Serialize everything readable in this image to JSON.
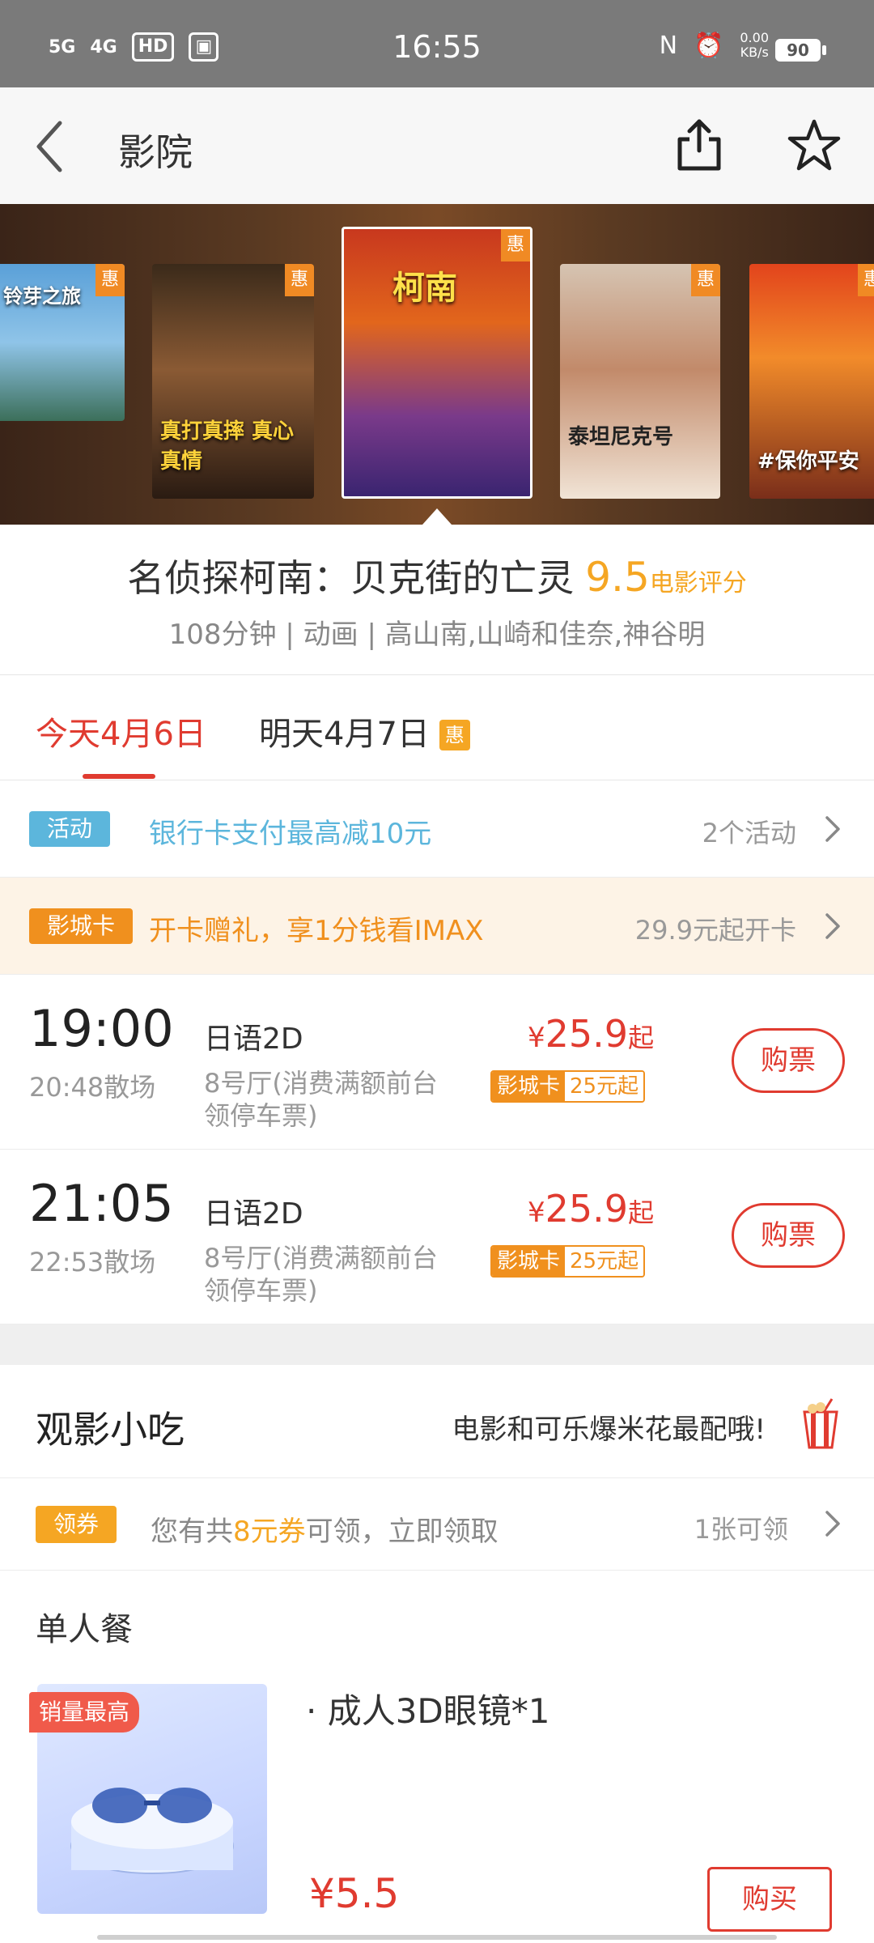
{
  "status_bar": {
    "net1": "5G",
    "net2": "4G",
    "hd": "HD",
    "time": "16:55",
    "nfc": "N",
    "speed_value": "0.00",
    "speed_unit": "KB/s",
    "battery": "90"
  },
  "header": {
    "title": "影院"
  },
  "posters": [
    {
      "badge": "惠",
      "text": "铃芽之旅"
    },
    {
      "badge": "惠",
      "text": "真打真摔 真心真情"
    },
    {
      "badge": "惠",
      "text": "柯南"
    },
    {
      "badge": "惠",
      "text": "泰坦尼克号"
    },
    {
      "badge": "惠",
      "text": "#保你平安"
    }
  ],
  "movie": {
    "title": "名侦探柯南：贝克街的亡灵",
    "score": "9.5",
    "score_label": "电影评分",
    "meta": "108分钟 | 动画 | 高山南,山崎和佳奈,神谷明"
  },
  "date_tabs": {
    "today": "今天4月6日",
    "tomorrow": "明天4月7日",
    "tomorrow_badge": "惠"
  },
  "promo_activity": {
    "tag": "活动",
    "text": "银行卡支付最高减10元",
    "right": "2个活动"
  },
  "promo_card": {
    "tag": "影城卡",
    "text": "开卡赠礼，享1分钱看IMAX",
    "right": "29.9元起开卡"
  },
  "showtimes": [
    {
      "start": "19:00",
      "end": "20:48散场",
      "lang": "日语2D",
      "hall": "8号厅(消费满额前台领停车票)",
      "currency": "¥",
      "price": "25.9",
      "price_suffix": "起",
      "card_label": "影城卡",
      "card_price": "25元起",
      "buy": "购票"
    },
    {
      "start": "21:05",
      "end": "22:53散场",
      "lang": "日语2D",
      "hall": "8号厅(消费满额前台领停车票)",
      "currency": "¥",
      "price": "25.9",
      "price_suffix": "起",
      "card_label": "影城卡",
      "card_price": "25元起",
      "buy": "购票"
    }
  ],
  "snacks": {
    "title": "观影小吃",
    "slogan": "电影和可乐爆米花最配哦!",
    "coupon_tag": "领券",
    "coupon_prefix": "您有共",
    "coupon_highlight": "8元券",
    "coupon_suffix": "可领，立即领取",
    "coupon_right": "1张可领",
    "meal_section": "单人餐",
    "meal_badge": "销量最高",
    "meal_item": "· 成人3D眼镜*1",
    "meal_price": "¥5.5",
    "meal_buy": "购买"
  },
  "colors": {
    "accent_red": "#e03b30",
    "orange": "#f0901e",
    "blue": "#5cb6dc"
  }
}
